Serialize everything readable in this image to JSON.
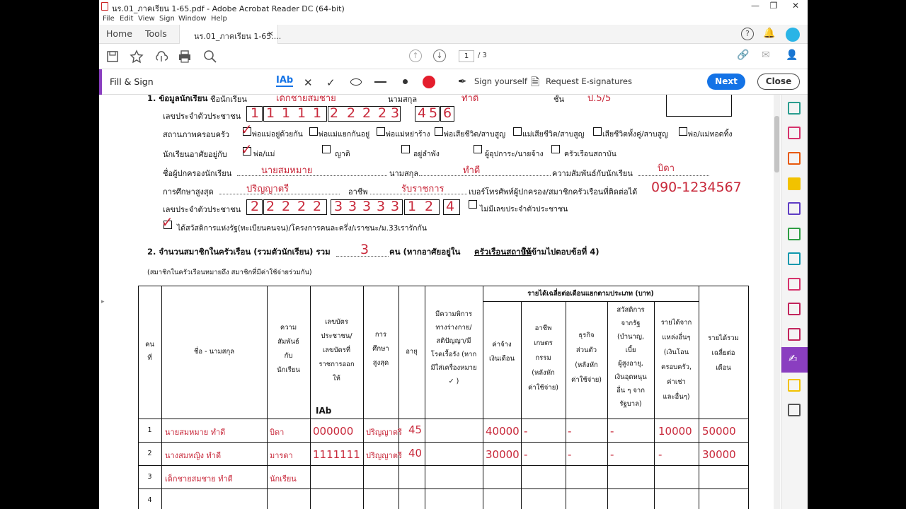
{
  "window": {
    "title": "นร.01_ภาคเรียน 1-65.pdf - Adobe Acrobat Reader DC (64-bit)",
    "minimize": "—",
    "restore": "❐",
    "close": "✕"
  },
  "menu": [
    "File",
    "Edit",
    "View",
    "Sign",
    "Window",
    "Help"
  ],
  "tabs": {
    "home": "Home",
    "tools": "Tools",
    "document": "นร.01_ภาคเรียน 1-65....",
    "document_close": "×"
  },
  "toolbar": {
    "page_current": "1",
    "page_total": "/ 3"
  },
  "fill_sign": {
    "label": "Fill & Sign",
    "text_tool": "Ab",
    "sign_yourself": "Sign yourself",
    "request_esign": "Request E-signatures",
    "next": "Next",
    "close": "Close"
  },
  "form": {
    "section1_title": "1. ข้อมูลนักเรียน",
    "name_label": "ชื่อนักเรียน",
    "name_value": "เด็กชายสมชาย",
    "surname_label": "นามสกุล",
    "surname_value": "ทำดี",
    "class_label": "ชั้น",
    "class_value": "ป.5/5",
    "id_label": "เลขประจำตัวประชาชน",
    "student_id_digits": [
      "1",
      "1",
      "1",
      "1",
      "1",
      "2",
      "2",
      "2",
      "2",
      "3",
      "4",
      "5",
      "6"
    ],
    "family_status_label": "สถานภาพครอบครัว",
    "family_status_options": [
      "พ่อแม่อยู่ด้วยกัน",
      "พ่อแม่แยกกันอยู่",
      "พ่อแม่หย่าร้าง",
      "พ่อเสียชีวิต/สาบสูญ",
      "แม่เสียชีวิต/สาบสูญ",
      "เสียชีวิตทั้งคู่/สาบสูญ",
      "พ่อ/แม่ทอดทิ้ง"
    ],
    "lives_with_label": "นักเรียนอาศัยอยู่กับ",
    "lives_with_options": [
      "พ่อ/แม่",
      "ญาติ",
      "อยู่ลำพัง",
      "ผู้อุปการะ/นายจ้าง",
      "ครัวเรือนสถาบัน"
    ],
    "guardian_label": "ชื่อผู้ปกครองนักเรียน",
    "guardian_value": "นายสมหมาย",
    "guardian_surname_label": "นามสกุล",
    "guardian_surname_value": "ทำดี",
    "relation_label": "ความสัมพันธ์กับนักเรียน",
    "relation_value": "บิดา",
    "education_label": "การศึกษาสูงสุด",
    "education_value": "ปริญญาตรี",
    "occupation_label": "อาชีพ",
    "occupation_value": "รับราชการ",
    "phone_label": "เบอร์โทรศัพท์ผู้ปกครอง/สมาชิกครัวเรือนที่ติดต่อได้",
    "phone_value": "090-1234567",
    "guardian_id_label": "เลขประจำตัวประชาชน",
    "guardian_id_digits": [
      "2",
      "2",
      "2",
      "2",
      "2",
      "3",
      "3",
      "3",
      "3",
      "3",
      "1",
      "2",
      "4"
    ],
    "no_id_label": "ไม่มีเลขประจำตัวประชาชน",
    "welfare_label": "ได้สวัสดิการแห่งรัฐ(ทะเบียนคนจน)/โครงการคนละครึ่ง/เราชนะ/ม.33เรารักกัน",
    "section2_prefix": "2. จำนวนสมาชิกในครัวเรือน (รวมตัวนักเรียน) รวม",
    "household_count": "3",
    "section2_suffix_a": "คน (หากอาศัยอยู่ใน",
    "section2_suffix_b": "ครัวเรือนสถาบัน",
    "section2_suffix_c": " ให้ข้ามไปตอบข้อที่ 4)",
    "section2_note": "(สมาชิกในครัวเรือนหมายถึง สมาชิกที่มีค่าใช้จ่ายร่วมกัน)",
    "cursor_text": "Ab"
  },
  "table": {
    "income_group_header": "รายได้เฉลี่ยต่อเดือนแยกตามประเภท  (บาท)",
    "headers": {
      "no": [
        "คน",
        "ที่"
      ],
      "name": [
        "ชื่อ - นามสกุล"
      ],
      "relation": [
        "ความ",
        "สัมพันธ์",
        "กับ",
        "นักเรียน"
      ],
      "idcard": [
        "เลขบัตร",
        "ประชาชน/",
        "เลขบัตรที่",
        "ราชการออก",
        "ให้"
      ],
      "education": [
        "การ",
        "ศึกษา",
        "สูงสุด"
      ],
      "age": [
        "อายุ"
      ],
      "disability": [
        "มีความพิการ",
        "ทางร่างกาย/",
        "สติปัญญา/มี",
        "โรคเรื้อรัง (หาก",
        "มีใส่เครื่องหมาย",
        "✓ )"
      ],
      "wage": [
        "ค่าจ้าง",
        "เงินเดือน"
      ],
      "agri": [
        "อาชีพ",
        "เกษตร",
        "กรรม",
        "(หลังหัก",
        "ค่าใช้จ่าย)"
      ],
      "business": [
        "ธุรกิจ",
        "ส่วนตัว",
        "(หลังหัก",
        "ค่าใช้จ่าย)"
      ],
      "welfare": [
        "สวัสดิการ",
        "จากรัฐ",
        "(บำนาญ,",
        "เบี้ย",
        "ผู้สูงอายุ,",
        "เงินอุดหนุน",
        "อื่น ๆ จาก",
        "รัฐบาล)"
      ],
      "other": [
        "รายได้จาก",
        "แหล่งอื่นๆ",
        "(เงินโอน",
        "ครอบครัว,",
        "ค่าเช่า",
        "และอื่นๆ)"
      ],
      "total": [
        "รายได้รวม",
        "เฉลี่ยต่อ",
        "เดือน"
      ]
    },
    "rows": [
      {
        "no": "1",
        "name": "นายสมหมาย  ทำดี",
        "relation": "บิดา",
        "idcard": "000000",
        "education": "ปริญญาตรี",
        "age": "45",
        "wage": "40000",
        "agri": "-",
        "business": "-",
        "welfare": "-",
        "other": "10000",
        "total": "50000"
      },
      {
        "no": "2",
        "name": "นางสมหญิง  ทำดี",
        "relation": "มารดา",
        "idcard": "1111111",
        "education": "ปริญญาตรี",
        "age": "40",
        "wage": "30000",
        "agri": "-",
        "business": "-",
        "welfare": "-",
        "other": "-",
        "total": "30000"
      },
      {
        "no": "3",
        "name": "เด็กชายสมชาย  ทำดี",
        "relation": "นักเรียน",
        "idcard": "",
        "education": "",
        "age": "",
        "wage": "",
        "agri": "",
        "business": "",
        "welfare": "",
        "other": "",
        "total": ""
      },
      {
        "no": "4",
        "name": "",
        "relation": "",
        "idcard": "",
        "education": "",
        "age": "",
        "wage": "",
        "agri": "",
        "business": "",
        "welfare": "",
        "other": "",
        "total": ""
      }
    ]
  },
  "colors": {
    "accent_blue": "#1473e6",
    "fill_sign_purple": "#8a3ec0",
    "handwriting_red": "#c8283a"
  }
}
